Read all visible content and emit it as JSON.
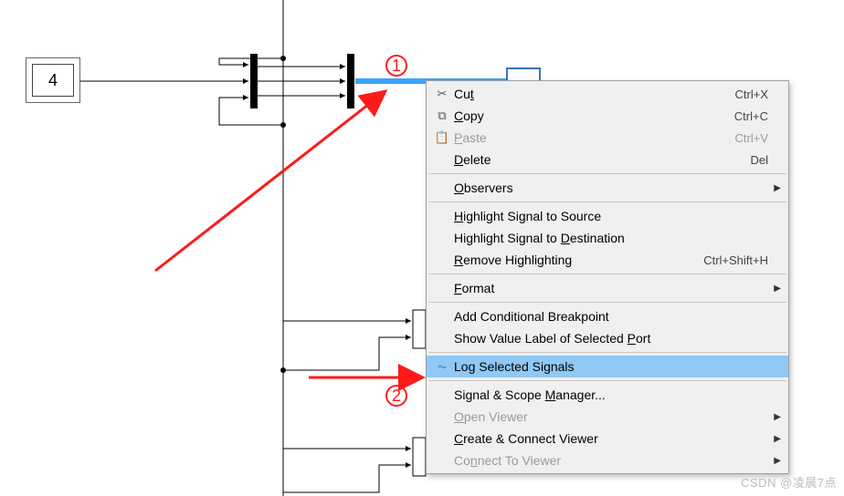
{
  "constant_block": {
    "value": "4"
  },
  "markers": {
    "one": "1",
    "two": "2"
  },
  "menu": {
    "cut": {
      "label": "Cut",
      "mn": "t",
      "shortcut": "Ctrl+X"
    },
    "copy": {
      "label": "Copy",
      "mn": "C",
      "shortcut": "Ctrl+C"
    },
    "paste": {
      "label": "Paste",
      "mn": "P",
      "shortcut": "Ctrl+V"
    },
    "delete": {
      "label": "Delete",
      "mn": "D",
      "shortcut": "Del"
    },
    "observers": {
      "label": "Observers",
      "mn": "O"
    },
    "hl_src": {
      "label": "Highlight Signal to Source",
      "mn": "H"
    },
    "hl_dst": {
      "label": "Highlight Signal to Destination",
      "mn": "D",
      "prefix": "Highlight Signal to "
    },
    "rm_hl": {
      "label": "Remove Highlighting",
      "mn": "R",
      "shortcut": "Ctrl+Shift+H"
    },
    "format": {
      "label": "Format",
      "mn": "F"
    },
    "add_bp": {
      "label": "Add Conditional Breakpoint"
    },
    "show_val": {
      "label": "Show Value Label of Selected Port",
      "mn": "P",
      "prefix": "Show Value Label of Selected "
    },
    "log_sel": {
      "label": "Log Selected Signals"
    },
    "sig_scope": {
      "label": "Signal & Scope Manager...",
      "mn": "M",
      "prefix": "Signal & Scope "
    },
    "open_view": {
      "label": "Open Viewer",
      "mn": "O"
    },
    "create_view": {
      "label": "Create & Connect Viewer",
      "mn": "C"
    },
    "connect_view": {
      "label": "Connect To Viewer",
      "mn": "n",
      "prefix": "Co",
      "suffix": "ect To Viewer"
    }
  },
  "watermark": "CSDN @凌晨7点"
}
